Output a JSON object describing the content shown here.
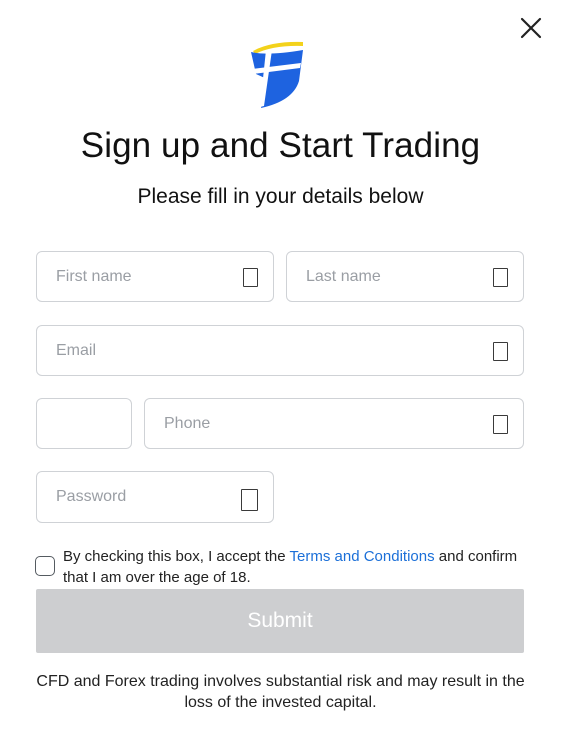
{
  "header": {
    "close_icon": "close-icon",
    "logo": "shield-logo",
    "title": "Sign up and Start Trading",
    "subtitle": "Please fill in your details below"
  },
  "form": {
    "first_name": {
      "placeholder": "First name",
      "value": ""
    },
    "last_name": {
      "placeholder": "Last name",
      "value": ""
    },
    "email": {
      "placeholder": "Email",
      "value": ""
    },
    "country_code": {
      "value": ""
    },
    "phone": {
      "placeholder": "Phone",
      "value": ""
    },
    "password": {
      "placeholder": "Password",
      "value": ""
    }
  },
  "consent": {
    "checked": false,
    "text_before": "By checking this box, I accept the ",
    "link_text": "Terms and Conditions",
    "text_after": " and confirm that I am over the age of 18."
  },
  "submit_label": "Submit",
  "disclaimer": "CFD and Forex trading involves substantial risk and may result in the loss of the invested capital.",
  "colors": {
    "brand_blue": "#1e63e0",
    "brand_yellow": "#f3d21b",
    "link": "#1b6fd8",
    "submit_disabled": "#cdced0"
  }
}
